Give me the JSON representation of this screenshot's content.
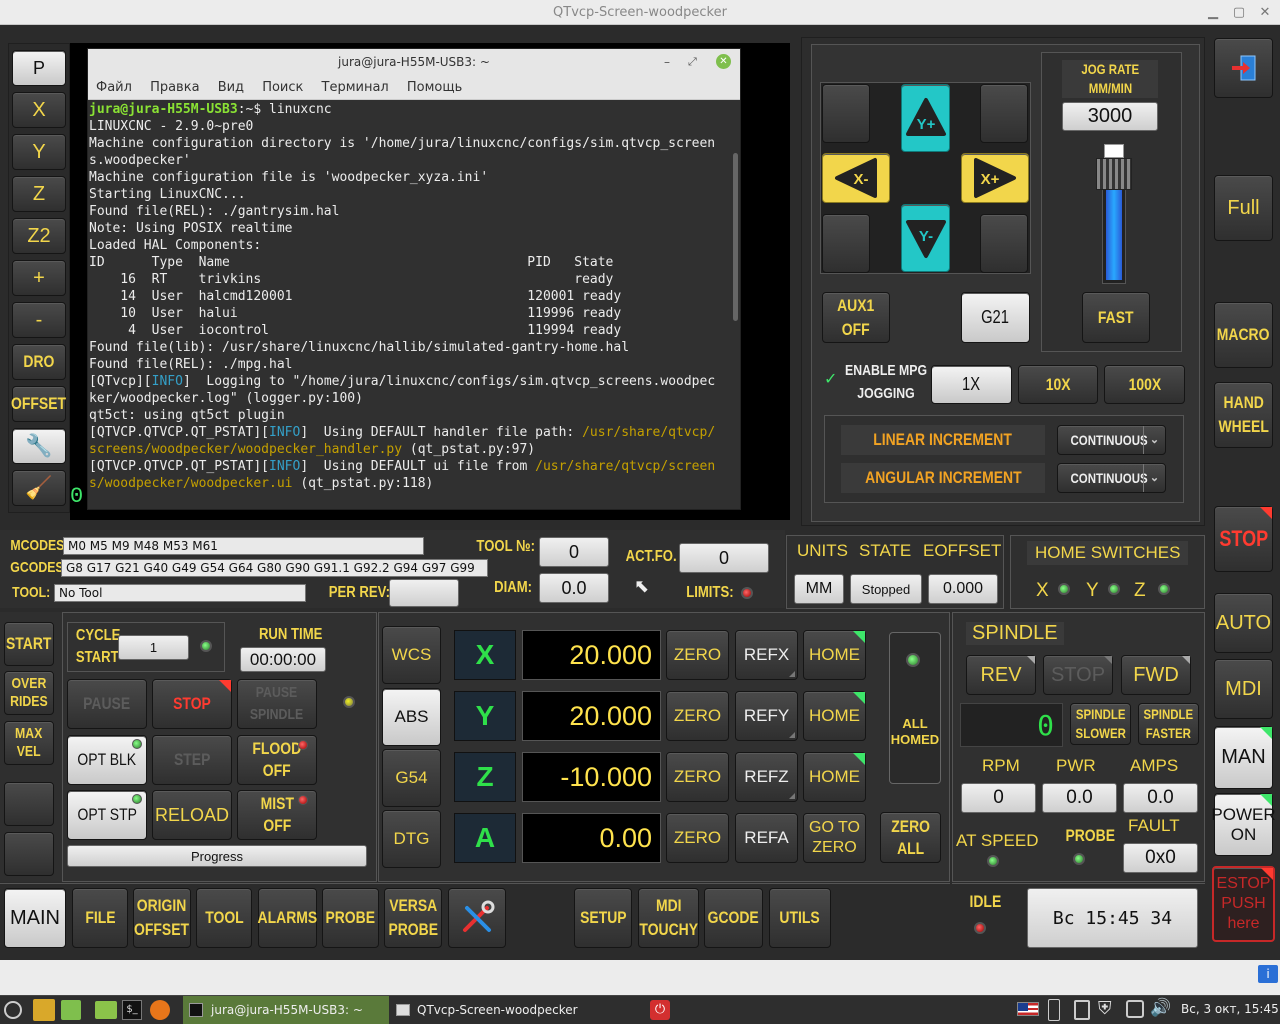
{
  "window": {
    "title": "QTvcp-Screen-woodpecker"
  },
  "terminal": {
    "title": "jura@jura-H55M-USB3: ~",
    "menu": [
      "Файл",
      "Правка",
      "Вид",
      "Поиск",
      "Терминал",
      "Помощь"
    ],
    "prompt_user": "jura@jura-H55M-USB3",
    "prompt_rest": ":~$ linuxcnc",
    "lines": [
      "LINUXCNC - 2.9.0~pre0",
      "Machine configuration directory is '/home/jura/linuxcnc/configs/sim.qtvcp_screen",
      "s.woodpecker'",
      "Machine configuration file is 'woodpecker_xyza.ini'",
      "Starting LinuxCNC...",
      "Found file(REL): ./gantrysim.hal",
      "Note: Using POSIX realtime",
      "Loaded HAL Components:",
      "ID      Type  Name                                      PID   State",
      "    16  RT    trivkins                                        ready",
      "    14  User  halcmd120001                              120001 ready",
      "    10  User  halui                                     119996 ready",
      "     4  User  iocontrol                                 119994 ready",
      "",
      "Found file(lib): /usr/share/linuxcnc/hallib/simulated-gantry-home.hal",
      "Found file(REL): ./mpg.hal"
    ],
    "log1a": "[QTvcp][",
    "info": "INFO",
    "log1b": "]  Logging to \"/home/jura/linuxcnc/configs/sim.qtvcp_screens.woodpec",
    "log1c": "ker/woodpecker.log\" (logger.py:100)",
    "log2": "qt5ct: using qt5ct plugin",
    "log3a": "[QTVCP.QTVCP.QT_PSTAT][",
    "log3b": "]  Using DEFAULT handler file path: ",
    "log3c": "/usr/share/qtvcp/",
    "log3d": "screens/woodpecker/woodpecker_handler.py",
    "log3e": " (qt_pstat.py:97)",
    "log4b": "]  Using DEFAULT ui file from ",
    "log4c": "/usr/share/qtvcp/screen",
    "log4d": "s/woodpecker/woodpecker.ui",
    "log4e": " (qt_pstat.py:118)"
  },
  "left_toolbar": [
    "P",
    "X",
    "Y",
    "Z",
    "Z2",
    "+",
    "-",
    "DRO",
    "OFFSET"
  ],
  "plot_zero": "0",
  "jog": {
    "rate_title1": "JOG RATE",
    "rate_title2": "MM/MIN",
    "rate_value": "3000",
    "y_plus": "Y+",
    "y_minus": "Y-",
    "x_minus": "X-",
    "x_plus": "X+",
    "aux1": "AUX1",
    "aux1_state": "OFF",
    "g21": "G21",
    "fast": "FAST",
    "enable_mpg1": "ENABLE MPG",
    "enable_mpg2": "JOGGING",
    "inc1": "1X",
    "inc10": "10X",
    "inc100": "100X",
    "linear_inc": "LINEAR INCREMENT",
    "angular_inc": "ANGULAR INCREMENT",
    "linear_value": "CONTINUOUS",
    "angular_value": "CONTINUOUS",
    "slider_fraction": 0.05
  },
  "right_bar": {
    "full": "Full",
    "macro": "MACRO",
    "hand1": "HAND",
    "hand2": "WHEEL",
    "stop": "STOP",
    "auto": "AUTO",
    "mdi": "MDI",
    "man": "MAN",
    "power1": "POWER",
    "power2": "ON",
    "estop1": "ESTOP",
    "estop2": "PUSH",
    "estop3": "here"
  },
  "codes": {
    "mcodes_label": "MCODES:",
    "mcodes": "M0 M5 M9 M48 M53 M61",
    "gcodes_label": "GCODES:",
    "gcodes": "G8 G17 G21 G40 G49 G54 G64 G80 G90 G91.1 G92.2 G94 G97 G99",
    "tool_label": "TOOL:",
    "tool": "No Tool",
    "toolnum_label": "TOOL №:",
    "toolnum": "0",
    "actfo_label": "ACT.FO.",
    "actfo": "0",
    "diam_label": "DIAM:",
    "diam": "0.0",
    "perrev_label": "PER REV:",
    "limits_label": "LIMITS:"
  },
  "status": {
    "units_label": "UNITS",
    "state_label": "STATE",
    "eoffset_label": "EOFFSET",
    "units": "MM",
    "state": "Stopped",
    "eoffset": "0.000",
    "home_switches": "HOME SWITCHES",
    "x": "X",
    "y": "Y",
    "z": "Z"
  },
  "program": {
    "start": "START",
    "overrides1": "OVER",
    "overrides2": "RIDES",
    "maxvel1": "MAX",
    "maxvel2": "VEL",
    "cycle1": "CYCLE",
    "cycle2": "START",
    "cycle_count": "1",
    "run_time_label": "RUN TIME",
    "run_time": "00:00:00",
    "pause": "PAUSE",
    "stop": "STOP",
    "pause_spindle1": "PAUSE",
    "pause_spindle2": "SPINDLE",
    "opt_blk": "OPT BLK",
    "step": "STEP",
    "flood1": "FLOOD",
    "flood2": "OFF",
    "opt_stp": "OPT STP",
    "reload": "RELOAD",
    "mist1": "MIST",
    "mist2": "OFF",
    "progress": "Progress"
  },
  "dro": {
    "modes": [
      "WCS",
      "ABS",
      "G54",
      "DTG"
    ],
    "axes": [
      {
        "name": "X",
        "value": "20.000",
        "ref": "REFX",
        "action": "HOME"
      },
      {
        "name": "Y",
        "value": "20.000",
        "ref": "REFY",
        "action": "HOME"
      },
      {
        "name": "Z",
        "value": "-10.000",
        "ref": "REFZ",
        "action": "HOME"
      },
      {
        "name": "A",
        "value": "0.00",
        "ref": "REFA",
        "action": "GO TO ZERO"
      }
    ],
    "zero": "ZERO",
    "all_homed1": "ALL",
    "all_homed2": "HOMED",
    "zero_all1": "ZERO",
    "zero_all2": "ALL"
  },
  "spindle": {
    "title": "SPINDLE",
    "rev": "REV",
    "stop": "STOP",
    "fwd": "FWD",
    "lcd": "0",
    "slower1": "SPINDLE",
    "slower2": "SLOWER",
    "faster1": "SPINDLE",
    "faster2": "FASTER",
    "rpm_label": "RPM",
    "pwr_label": "PWR",
    "amps_label": "AMPS",
    "rpm": "0",
    "pwr": "0.0",
    "amps": "0.0",
    "at_speed": "AT SPEED",
    "probe": "PROBE",
    "fault_label": "FAULT",
    "fault": "0x0"
  },
  "tabs": {
    "main": "MAIN",
    "file": "FILE",
    "origin1": "ORIGIN",
    "origin2": "OFFSET",
    "tool": "TOOL",
    "alarms": "ALARMS",
    "probe": "PROBE",
    "versa1": "VERSA",
    "versa2": "PROBE",
    "setup": "SETUP",
    "mdi1": "MDI",
    "mdi2": "TOUCHY",
    "gcode": "GCODE",
    "utils": "UTILS"
  },
  "idle": {
    "label": "IDLE",
    "clock": "Вс  15:45  34"
  },
  "taskbar": {
    "terminal": "jura@jura-H55M-USB3: ~",
    "qtvcp": "QTvcp-Screen-woodpecker",
    "datetime": "Вс, 3 окт, 15:45"
  }
}
